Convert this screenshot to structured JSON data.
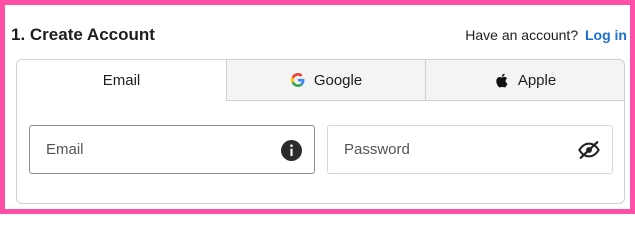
{
  "header": {
    "title": "1. Create Account",
    "have_account_text": "Have an account?",
    "login_label": "Log in"
  },
  "tabs": [
    {
      "label": "Email",
      "icon": "",
      "active": true
    },
    {
      "label": "Google",
      "icon": "google-icon",
      "active": false
    },
    {
      "label": "Apple",
      "icon": "apple-icon",
      "active": false
    }
  ],
  "form": {
    "email": {
      "placeholder": "Email",
      "value": "",
      "icon": "info-icon"
    },
    "password": {
      "placeholder": "Password",
      "value": "",
      "icon": "eye-slash-icon"
    }
  },
  "colors": {
    "frame_border": "#ff4fa6",
    "link": "#1a6fd0"
  }
}
